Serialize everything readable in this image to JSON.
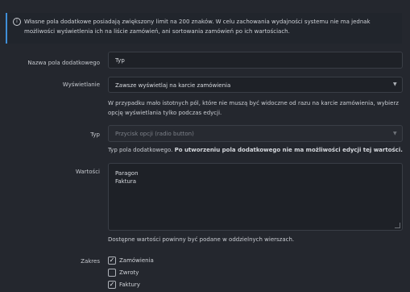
{
  "info": {
    "icon": "info-circle-icon",
    "text": "Własne pola dodatkowe posiadają zwiększony limit na 200 znaków. W celu zachowania wydajności systemu nie ma jednak możliwości wyświetlenia ich na liście zamówień, ani sortowania zamówień po ich wartościach."
  },
  "fields": {
    "name": {
      "label": "Nazwa pola dodatkowego",
      "value": "Typ"
    },
    "display": {
      "label": "Wyświetlanie",
      "value": "Zawsze wyświetlaj na karcie zamówienia",
      "help": "W przypadku mało istotnych pól, które nie muszą być widoczne od razu na karcie zamówienia, wybierz opcję wyświetlania tylko podczas edycji."
    },
    "type": {
      "label": "Typ",
      "value": "Przycisk opcji (radio button)",
      "help_normal": "Typ pola dodatkowego. ",
      "help_bold": "Po utworzeniu pola dodatkowego nie ma możliwości edycji tej wartości."
    },
    "values": {
      "label": "Wartości",
      "lines": [
        "Paragon",
        "Faktura"
      ],
      "help": "Dostępne wartości powinny być podane w oddzielnych wierszach."
    },
    "scope": {
      "label": "Zakres",
      "options": [
        {
          "label": "Zamówienia",
          "checked": true
        },
        {
          "label": "Zwroty",
          "checked": false
        },
        {
          "label": "Faktury",
          "checked": true
        }
      ]
    }
  },
  "colors": {
    "background": "#24272e",
    "input_bg": "#1e2127",
    "border": "#3a3e46",
    "info_accent": "#3f8ed8"
  }
}
